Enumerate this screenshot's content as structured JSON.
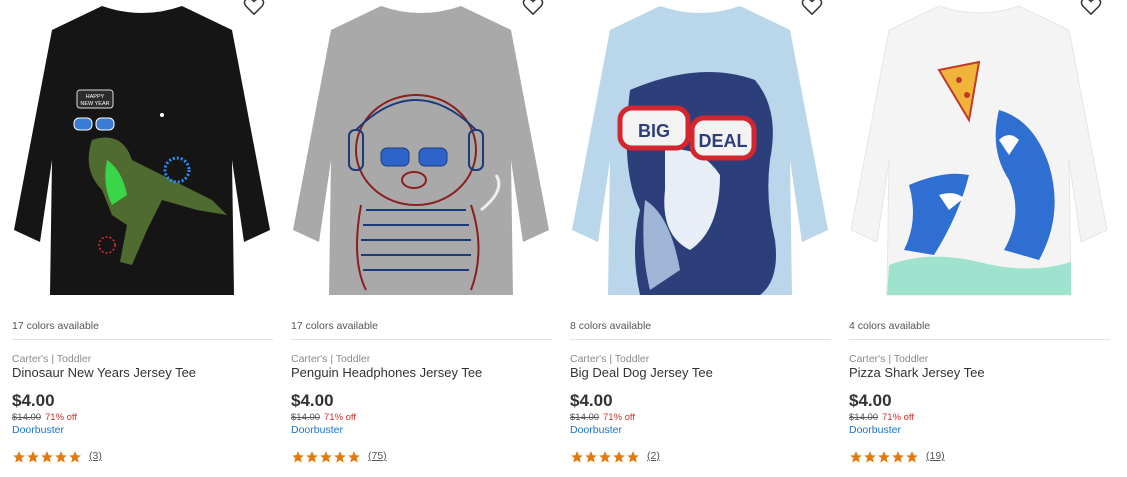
{
  "products": [
    {
      "colors_available": "17 colors available",
      "brand": "Carter's | Toddler",
      "title": "Dinosaur New Years Jersey Tee",
      "price": "$4.00",
      "original_price": "$14.00",
      "discount": "71% off",
      "promo": "Doorbuster",
      "rating": 5,
      "review_count": "(3)",
      "shirt_color": "#151515",
      "print_text": "HAPPY NEW YEAR"
    },
    {
      "colors_available": "17 colors available",
      "brand": "Carter's | Toddler",
      "title": "Penguin Headphones Jersey Tee",
      "price": "$4.00",
      "original_price": "$14.00",
      "discount": "71% off",
      "promo": "Doorbuster",
      "rating": 5,
      "review_count": "(75)",
      "shirt_color": "#a9a9a9",
      "print_text": ""
    },
    {
      "colors_available": "8 colors available",
      "brand": "Carter's | Toddler",
      "title": "Big Deal Dog Jersey Tee",
      "price": "$4.00",
      "original_price": "$14.00",
      "discount": "71% off",
      "promo": "Doorbuster",
      "rating": 5,
      "review_count": "(2)",
      "shirt_color": "#b9d6ea",
      "print_text": "BIG DEAL"
    },
    {
      "colors_available": "4 colors available",
      "brand": "Carter's | Toddler",
      "title": "Pizza Shark Jersey Tee",
      "price": "$4.00",
      "original_price": "$14.00",
      "discount": "71% off",
      "promo": "Doorbuster",
      "rating": 5,
      "review_count": "(19)",
      "shirt_color": "#f4f4f4",
      "print_text": ""
    }
  ],
  "colors": {
    "star": "#e07a10",
    "discount": "#d0312d",
    "promo": "#1a73c8"
  },
  "icons": {
    "wishlist": "heart-outline-icon",
    "rating": "star-icon"
  }
}
